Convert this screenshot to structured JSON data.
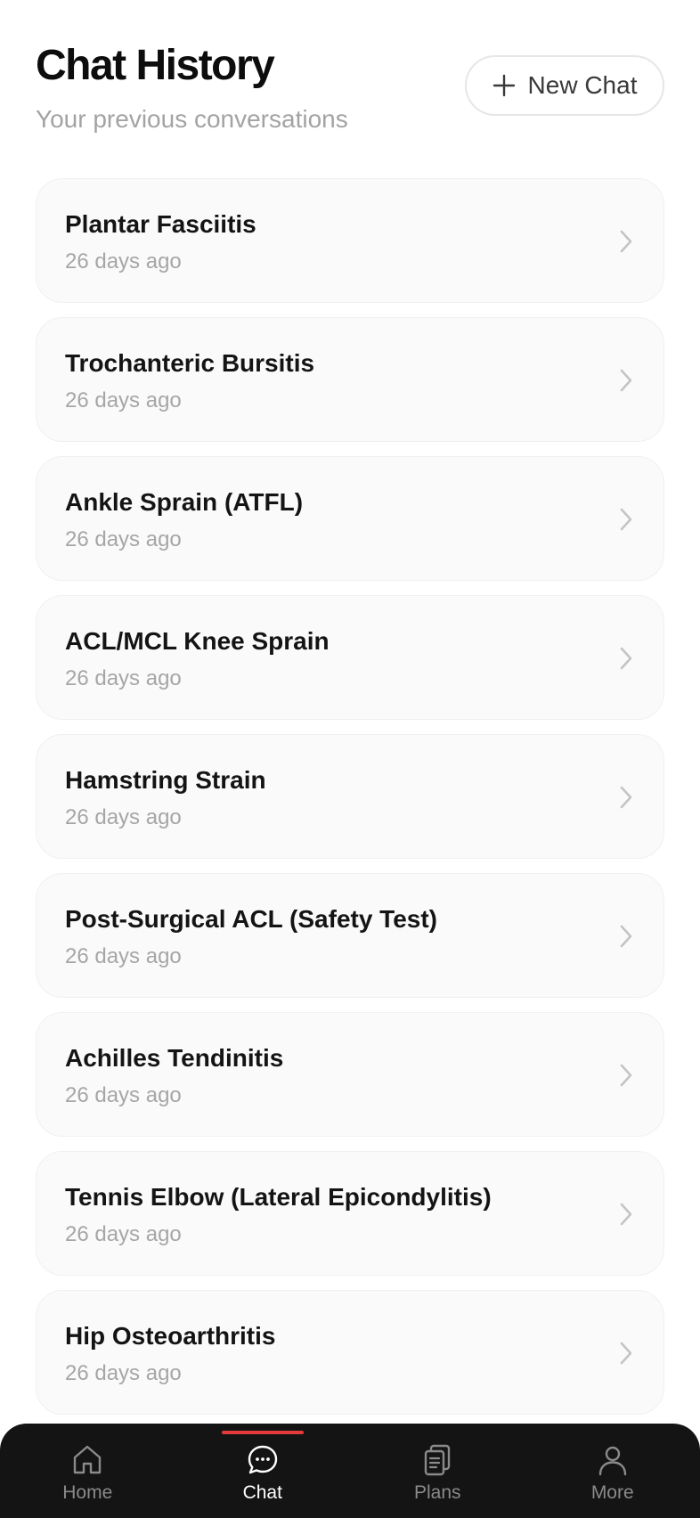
{
  "header": {
    "title": "Chat History",
    "subtitle": "Your previous conversations",
    "new_chat_label": "New Chat"
  },
  "chats": [
    {
      "title": "Plantar Fasciitis",
      "time": "26 days ago"
    },
    {
      "title": "Trochanteric Bursitis",
      "time": "26 days ago"
    },
    {
      "title": "Ankle Sprain (ATFL)",
      "time": "26 days ago"
    },
    {
      "title": "ACL/MCL Knee Sprain",
      "time": "26 days ago"
    },
    {
      "title": "Hamstring Strain",
      "time": "26 days ago"
    },
    {
      "title": "Post-Surgical ACL (Safety Test)",
      "time": "26 days ago"
    },
    {
      "title": "Achilles Tendinitis",
      "time": "26 days ago"
    },
    {
      "title": "Tennis Elbow (Lateral Epicondylitis)",
      "time": "26 days ago"
    },
    {
      "title": "Hip Osteoarthritis",
      "time": "26 days ago"
    }
  ],
  "nav": {
    "items": [
      {
        "label": "Home",
        "icon": "home-icon"
      },
      {
        "label": "Chat",
        "icon": "chat-bubble-icon"
      },
      {
        "label": "Plans",
        "icon": "clipboard-icon"
      },
      {
        "label": "More",
        "icon": "user-icon"
      }
    ],
    "active": "Chat"
  },
  "colors": {
    "accent": "#e33b3b",
    "nav_background": "#141414",
    "card_background": "#fafafa",
    "muted_text": "#a6a6a6"
  }
}
